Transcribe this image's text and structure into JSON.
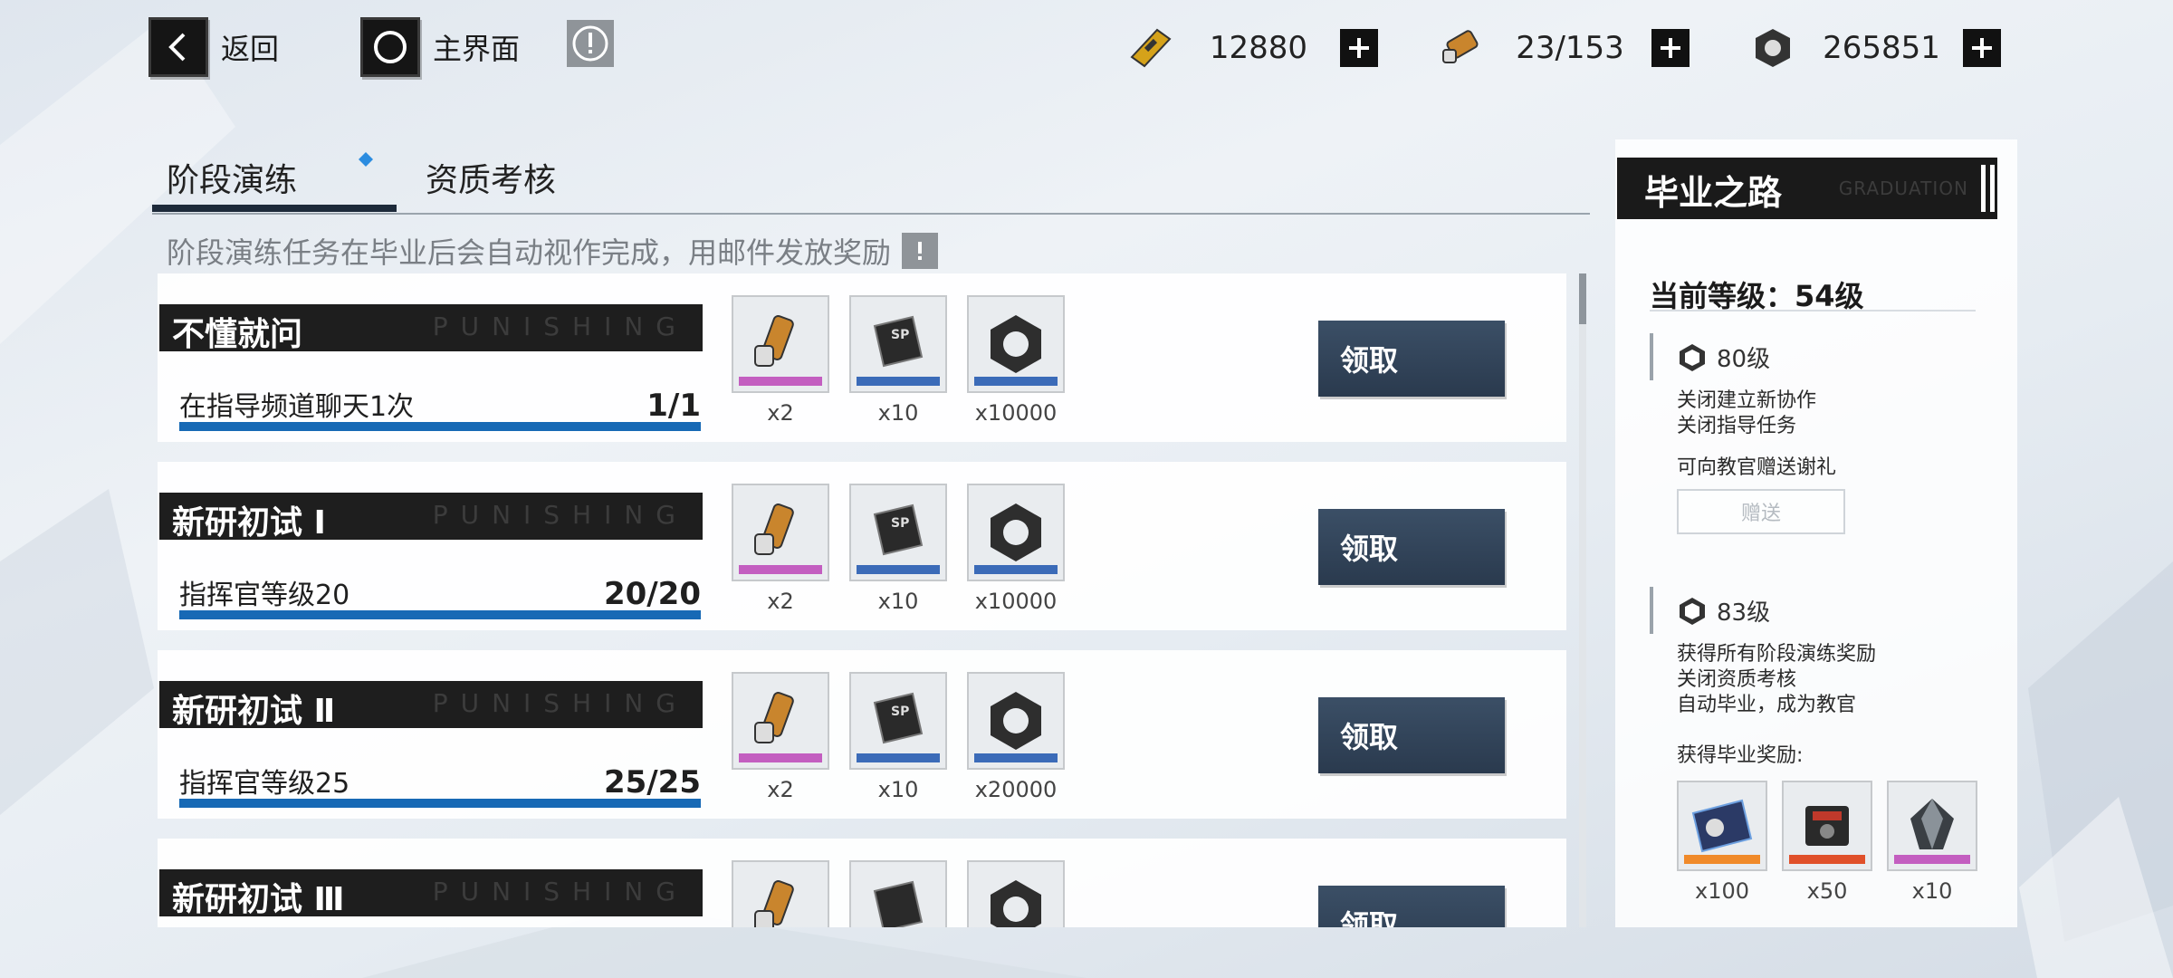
{
  "topbar": {
    "back_label": "返回",
    "home_label": "主界面",
    "resources": [
      {
        "icon": "gold-card-icon",
        "value": "12880"
      },
      {
        "icon": "battery-icon",
        "value": "23/153"
      },
      {
        "icon": "hex-nut-icon",
        "value": "265851"
      }
    ]
  },
  "tabs": [
    {
      "label": "阶段演练",
      "active": true
    },
    {
      "label": "资质考核",
      "active": false
    }
  ],
  "notice": "阶段演练任务在毕业后会自动视作完成，用邮件发放奖励",
  "watermark": "PUNISHING",
  "tasks": [
    {
      "title": "不懂就问",
      "desc": "在指导频道聊天1次",
      "progress": "1/1",
      "fill": 1.0,
      "rewards": [
        {
          "icon": "battery-icon",
          "count": "x2"
        },
        {
          "icon": "sp-chip-icon",
          "count": "x10"
        },
        {
          "icon": "hex-nut-icon",
          "count": "x10000"
        }
      ],
      "claim": "领取"
    },
    {
      "title": "新研初试 Ⅰ",
      "desc": "指挥官等级20",
      "progress": "20/20",
      "fill": 1.0,
      "rewards": [
        {
          "icon": "battery-icon",
          "count": "x2"
        },
        {
          "icon": "sp-chip-icon",
          "count": "x10"
        },
        {
          "icon": "hex-nut-icon",
          "count": "x10000"
        }
      ],
      "claim": "领取"
    },
    {
      "title": "新研初试 Ⅱ",
      "desc": "指挥官等级25",
      "progress": "25/25",
      "fill": 1.0,
      "rewards": [
        {
          "icon": "battery-icon",
          "count": "x2"
        },
        {
          "icon": "sp-chip-icon",
          "count": "x10"
        },
        {
          "icon": "hex-nut-icon",
          "count": "x20000"
        }
      ],
      "claim": "领取"
    },
    {
      "title": "新研初试 Ⅲ",
      "desc": "",
      "progress": "",
      "fill": 1.0,
      "rewards": [
        {
          "icon": "battery-icon",
          "count": ""
        },
        {
          "icon": "sp-chip-icon",
          "count": ""
        },
        {
          "icon": "hex-nut-icon",
          "count": ""
        }
      ],
      "claim": "领取"
    }
  ],
  "panel": {
    "title": "毕业之路",
    "subtitle": "GRADUATION",
    "current_level": "当前等级：54级",
    "milestones": [
      {
        "level": "80级",
        "lines": [
          "关闭建立新协作",
          "关闭指导任务"
        ],
        "extra": "可向教官赠送谢礼",
        "button": "赠送"
      },
      {
        "level": "83级",
        "lines": [
          "获得所有阶段演练奖励",
          "关闭资质考核",
          "自动毕业，成为教官"
        ],
        "extra": "获得毕业奖励:"
      }
    ],
    "grad_rewards": [
      {
        "icon": "character-card-icon",
        "count": "x100"
      },
      {
        "icon": "chip-box-icon",
        "count": "x50"
      },
      {
        "icon": "crystal-icon",
        "count": "x10"
      }
    ]
  }
}
